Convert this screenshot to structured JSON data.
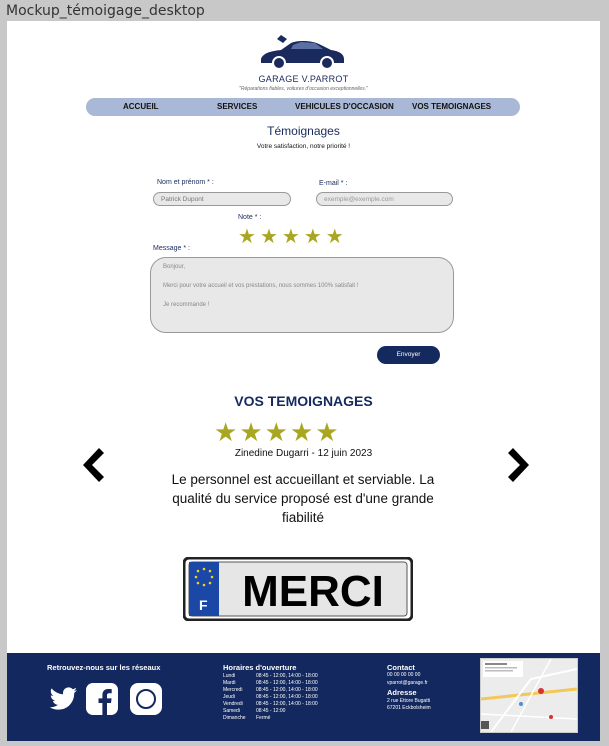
{
  "frame_label": "Mockup_témoigage_desktop",
  "brand": {
    "name": "GARAGE V.PARROT",
    "tagline": "\"Réparations fiables, voitures d'occasion exceptionnelles.\""
  },
  "nav": {
    "items": [
      "ACCUEIL",
      "SERVICES",
      "VEHICULES D'OCCASION",
      "VOS TEMOIGNAGES"
    ]
  },
  "form": {
    "title": "Témoignages",
    "subtitle": "Votre satisfaction, notre priorité !",
    "name_label": "Nom et prénom * :",
    "name_value": "Patrick Dupont",
    "email_label": "E-mail * :",
    "email_placeholder": "exemple@exemple.com",
    "rating_label": "Note * :",
    "rating": 5,
    "message_label": "Message * :",
    "message_lines": [
      "Bonjour,",
      "Merci pour votre accueil et vos prestations, nous sommes 100% satisfait !",
      "Je recommande !"
    ],
    "submit_label": "Envoyer"
  },
  "testimonials": {
    "heading": "VOS TEMOIGNAGES",
    "rating": 5,
    "reviewer": "Zinedine Dugarri - 12 juin 2023",
    "quote": "Le personnel est accueillant et serviable. La qualité du service proposé est d'une grande fiabilité"
  },
  "plate": {
    "country": "F",
    "text": "MERCI"
  },
  "footer": {
    "social_heading": "Retrouvez-nous sur les réseaux",
    "social_icons": [
      "twitter-icon",
      "facebook-icon",
      "instagram-icon"
    ],
    "hours_heading": "Horaires d'ouverture",
    "hours": [
      {
        "day": "Lundi",
        "time": "08:45 - 12:00, 14:00 - 18:00"
      },
      {
        "day": "Mardi",
        "time": "08:45 - 12:00, 14:00 - 18:00"
      },
      {
        "day": "Mercredi",
        "time": "08:45 - 12:00, 14:00 - 18:00"
      },
      {
        "day": "Jeudi",
        "time": "08:45 - 12:00, 14:00 - 18:00"
      },
      {
        "day": "Vendredi",
        "time": "08:45 - 12:00, 14:00 - 18:00"
      },
      {
        "day": "Samedi",
        "time": "08:45 - 12:00"
      },
      {
        "day": "Dimanche",
        "time": "Fermé"
      }
    ],
    "contact_heading": "Contact",
    "phone": "00 00 00 00 00",
    "email": "vparrot@garage.fr",
    "address_heading": "Adresse",
    "address_line1": "2 rue Ettore Bugatti",
    "address_line2": "67201 Eckbolsheim"
  },
  "colors": {
    "navy": "#13285e",
    "nav_bg": "#a9b8d6",
    "star": "#a9a722"
  }
}
